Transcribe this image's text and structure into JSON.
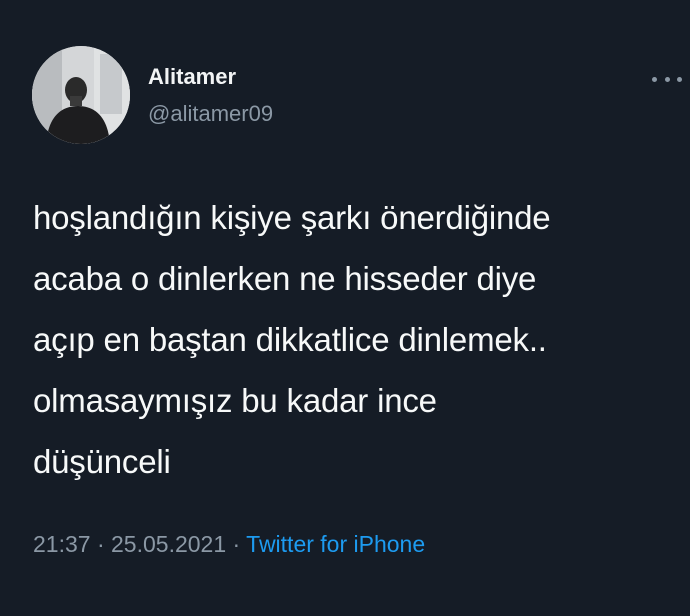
{
  "tweet": {
    "author": {
      "display_name": "Alitamer",
      "handle": "@alitamer09"
    },
    "text_lines": [
      "hoşlandığın kişiye şarkı önerdiğinde",
      "acaba o dinlerken ne hisseder diye",
      "açıp en baştan dikkatlice dinlemek..",
      "olmasaymışız bu kadar ince",
      "düşünceli"
    ],
    "time": "21:37",
    "separator": "·",
    "date": "25.05.2021",
    "source": "Twitter for iPhone"
  },
  "icons": {
    "more": "more-horizontal-icon",
    "avatar": "profile-photo"
  },
  "colors": {
    "background": "#151c26",
    "primary_text": "#f7f9f9",
    "secondary_text": "#8b98a5",
    "link": "#1d9bf0"
  }
}
